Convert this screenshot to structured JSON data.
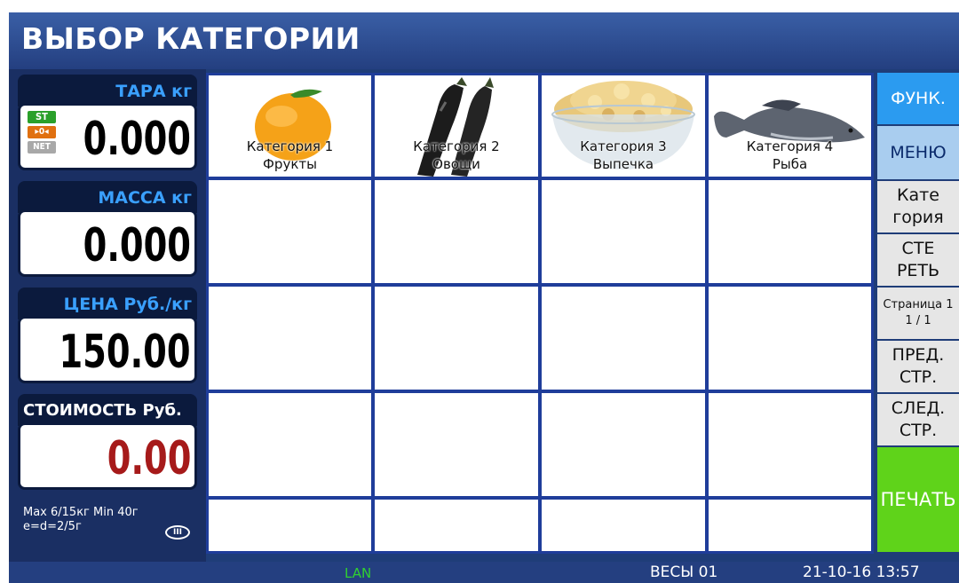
{
  "title": "ВЫБОР КАТЕГОРИИ",
  "tare": {
    "label": "ТАРА кг",
    "value": "0.000"
  },
  "indicators": {
    "stable": "ST",
    "zero": "▸0◂",
    "net": "NET"
  },
  "mass": {
    "label": "МАССА кг",
    "value": "0.000"
  },
  "price": {
    "label": "ЦЕНА Руб./кг",
    "value": "150.00"
  },
  "cost": {
    "label": "СТОИМОСТЬ Руб.",
    "value": "0.00"
  },
  "specs": {
    "line1": "Max 6/15кг Min 40г",
    "line2": "e=d=2/5г",
    "class": "III"
  },
  "categories": [
    {
      "name": "Категория 1",
      "sub": "Фрукты",
      "icon": "orange-icon"
    },
    {
      "name": "Категория 2",
      "sub": "Овощи",
      "icon": "eggplant-icon"
    },
    {
      "name": "Категория 3",
      "sub": "Выпечка",
      "icon": "popcorn-bowl-icon"
    },
    {
      "name": "Категория 4",
      "sub": "Рыба",
      "icon": "fish-icon"
    }
  ],
  "right_menu": {
    "func": "ФУНК.",
    "menu": "МЕНЮ",
    "category_1": "Кате",
    "category_2": "гория",
    "erase_1": "СТЕ",
    "erase_2": "РЕТЬ",
    "page_label": "Страница 1",
    "page_value": "1 / 1",
    "prev_1": "ПРЕД.",
    "prev_2": "СТР.",
    "next_1": "СЛЕД.",
    "next_2": "СТР.",
    "print": "ПЕЧАТЬ"
  },
  "status": {
    "lan": "LAN",
    "scale": "ВЕСЫ 01",
    "datetime": "21-10-16  13:57"
  },
  "colors": {
    "accent_blue": "#3aa0ff",
    "print_green": "#5fd31a",
    "cost_red": "#a61a1a"
  }
}
